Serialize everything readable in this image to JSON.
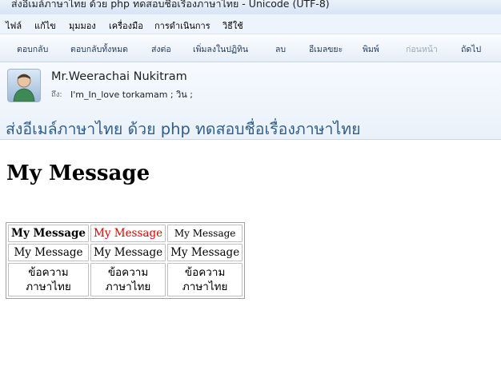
{
  "window": {
    "title": "ส่งอีเมล์ภาษาไทย ด้วย php ทดสอบชื่อเรื่องภาษาไทย - Unicode (UTF-8)"
  },
  "menu": [
    "ไฟล์",
    "แก้ไข",
    "มุมมอง",
    "เครื่องมือ",
    "การดำเนินการ",
    "วิธีใช้"
  ],
  "toolbar": [
    "ตอบกลับ",
    "ตอบกลับทั้งหมด",
    "ส่งต่อ",
    "เพิ่มลงในปฏิทิน",
    "ลบ",
    "อีเมลขยะ",
    "พิมพ์",
    "ก่อนหน้า",
    "ถัดไป"
  ],
  "header": {
    "sender": "Mr.Weerachai Nukitram",
    "to_label": "ถึง:",
    "to_value": "I'm_In_love torkamam ; วิน ;",
    "subject": "ส่งอีเมล์ภาษาไทย ด้วย php ทดสอบชื่อเรื่องภาษาไทย"
  },
  "body": {
    "heading": "My Message",
    "table": [
      [
        "My Message",
        "My Message",
        "My Message"
      ],
      [
        "My Message",
        "My Message",
        "My Message"
      ],
      [
        [
          "ข้อความ",
          "ภาษาไทย"
        ],
        [
          "ข้อความ",
          "ภาษาไทย"
        ],
        [
          "ข้อความ",
          "ภาษาไทย"
        ]
      ]
    ]
  },
  "colors": {
    "subject": "#2e5f8c",
    "red_text": "#e00000"
  },
  "icons": {
    "avatar": "person-icon"
  }
}
